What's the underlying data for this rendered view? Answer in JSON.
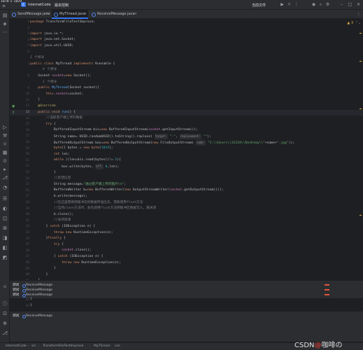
{
  "titlebar": {
    "dims": "1878 × 1829",
    "project_badge": "IC",
    "project_name": "InternetCode",
    "vcs": "版本控制",
    "run_config": "当前文件"
  },
  "tabs": [
    {
      "label": "SendMessage.java"
    },
    {
      "label": "MyThread.java"
    },
    {
      "label": "ReceiveMessage.java"
    }
  ],
  "inspection": {
    "count": "3"
  },
  "code_lines": [
    {
      "n": "1",
      "html": "<span class=\"kw\">package</span> TransformFileTestImprove;"
    },
    {
      "n": "2",
      "html": ""
    },
    {
      "n": "3",
      "html": "<span class=\"kw\">import</span> java.io.*;"
    },
    {
      "n": "4",
      "html": "<span class=\"kw\">import</span> java.net.Socket;"
    },
    {
      "n": "5",
      "html": "<span class=\"kw\">import</span> java.util.UUID;"
    },
    {
      "n": "6",
      "html": ""
    },
    {
      "n": "7",
      "html": "<span class=\"kw\">public class</span> MyThread <span class=\"kw\">implements</span> Runnable {"
    },
    {
      "n": "8",
      "html": "    Socket <span class=\"fld\">socket</span>=<span class=\"kw\">new</span> Socket();"
    },
    {
      "n": "9",
      "html": "    <span class=\"kw\">public</span> <span class=\"fn\">MyThread</span>(Socket socket){"
    },
    {
      "n": "10",
      "html": "        <span class=\"kw\">this</span>.<span class=\"fld\">socket</span>=socket;"
    },
    {
      "n": "11",
      "html": "    }"
    },
    {
      "n": "12",
      "html": "    <span class=\"ann\">@Override</span>"
    },
    {
      "n": "13",
      "html": "    <span class=\"kw\">public void</span> <span class=\"fn\">run</span>() {"
    },
    {
      "n": "14",
      "html": "        <span class=\"cmt\">//读取客户端上传的数据</span>"
    },
    {
      "n": "15",
      "html": "        <span class=\"kw\">try</span> {"
    },
    {
      "n": "16",
      "html": "            BufferedInputStream bis=<span class=\"kw\">new</span> BufferedInputStream(<span class=\"fld\">socket</span>.getInputStream());"
    },
    {
      "n": "17",
      "html": "            String name= UUID.<i>randomUUID</i>().toString().replace( <span class=\"param\">target:</span> <span class=\"str\">\"-\"</span>, <span class=\"param\">replacement:</span> <span class=\"str\">\"\"</span>);"
    },
    {
      "n": "18",
      "html": "            BufferedOutputStream bos=<span class=\"kw\">new</span> BufferedOutputStream(<span class=\"kw\">new</span> FileOutputStream( <span class=\"param\">name:</span> <span class=\"str\">\"C:\\\\Users\\\\31234\\\\Desktop\\\\\"</span>+name+<span class=\"str\">\".jpg\"</span>));"
    },
    {
      "n": "19",
      "html": "            <span class=\"kw\">byte</span>[] bytes = <span class=\"kw\">new byte</span>[<span class=\"num\">1024</span>];"
    },
    {
      "n": "20",
      "html": "            <span class=\"kw\">int</span> len;"
    },
    {
      "n": "21",
      "html": "            <span class=\"kw\">while</span> ((len=bis.read(bytes))!=<span class=\"num\">-1</span>){"
    },
    {
      "n": "22",
      "html": "                bos.write(bytes, <span class=\"param\">off:</span> <span class=\"num\">0</span>,len);"
    },
    {
      "n": "23",
      "html": "            }"
    },
    {
      "n": "24",
      "html": "            <span class=\"cmt\">//反馈信息</span>"
    },
    {
      "n": "25",
      "html": "            String message=<span class=\"str\">\"通过客户端上传的图片\\n\"</span>;"
    },
    {
      "n": "26",
      "html": "            BufferedWriter b=<span class=\"kw\">new</span> BufferedWriter(<span class=\"kw\">new</span> OutputStreamWriter(<span class=\"fld\">socket</span>.getOutputStream()));"
    },
    {
      "n": "27",
      "html": "            b.write(message);"
    },
    {
      "n": "28",
      "html": "            <span class=\"cmt\">//在这里需要把缓冲流的数据传送出去，需要使用flush方法</span>"
    },
    {
      "n": "29",
      "html": "            <span class=\"cmt\">//当然close方法时，会先调用flush方法把缓冲区数据写入，再关闭</span>"
    },
    {
      "n": "30",
      "html": "            b.close();"
    },
    {
      "n": "31",
      "html": "            <span class=\"cmt\">//关闭资源</span>"
    },
    {
      "n": "32",
      "html": "        } <span class=\"kw\">catch</span> (IOException e) {"
    },
    {
      "n": "33",
      "html": "            <span class=\"kw\">throw new</span> RuntimeException(e);"
    },
    {
      "n": "34",
      "html": "        }<span class=\"kw\">finally</span> {"
    },
    {
      "n": "35",
      "html": "            <span class=\"kw\">try</span> {"
    },
    {
      "n": "36",
      "html": "                <span class=\"fld\">socket</span>.close();"
    },
    {
      "n": "37",
      "html": "            } <span class=\"kw\">catch</span> (IOException e) {"
    },
    {
      "n": "38",
      "html": "                <span class=\"kw\">throw new</span> RuntimeException(e);"
    },
    {
      "n": "39",
      "html": "            }"
    },
    {
      "n": "40",
      "html": "        }"
    },
    {
      "n": "41",
      "html": "    }"
    }
  ],
  "usage_hints": {
    "class_usages": "1 个用法",
    "field_usages": "4 个用法",
    "ctor_usages": "1 个用法"
  },
  "debug_rows": [
    {
      "label": "调试",
      "value": "ReceiveMessage"
    },
    {
      "label": "调试",
      "value": "ReceiveMessage"
    },
    {
      "label": "调试",
      "value": "ReceiveMessage"
    }
  ],
  "editor2_lines": [
    {
      "n": "42",
      "text": "    }"
    },
    {
      "n": "43",
      "text": "}"
    }
  ],
  "debug_bottom": {
    "label": "调试",
    "value": "ReceiveMessage"
  },
  "breadcrumb": [
    "InternetCode",
    "src",
    "TransformFileTestImprove",
    "MyThread",
    "run"
  ],
  "watermark": {
    "brand": "CSDN",
    "at": "@",
    "user": "咖啡の"
  }
}
